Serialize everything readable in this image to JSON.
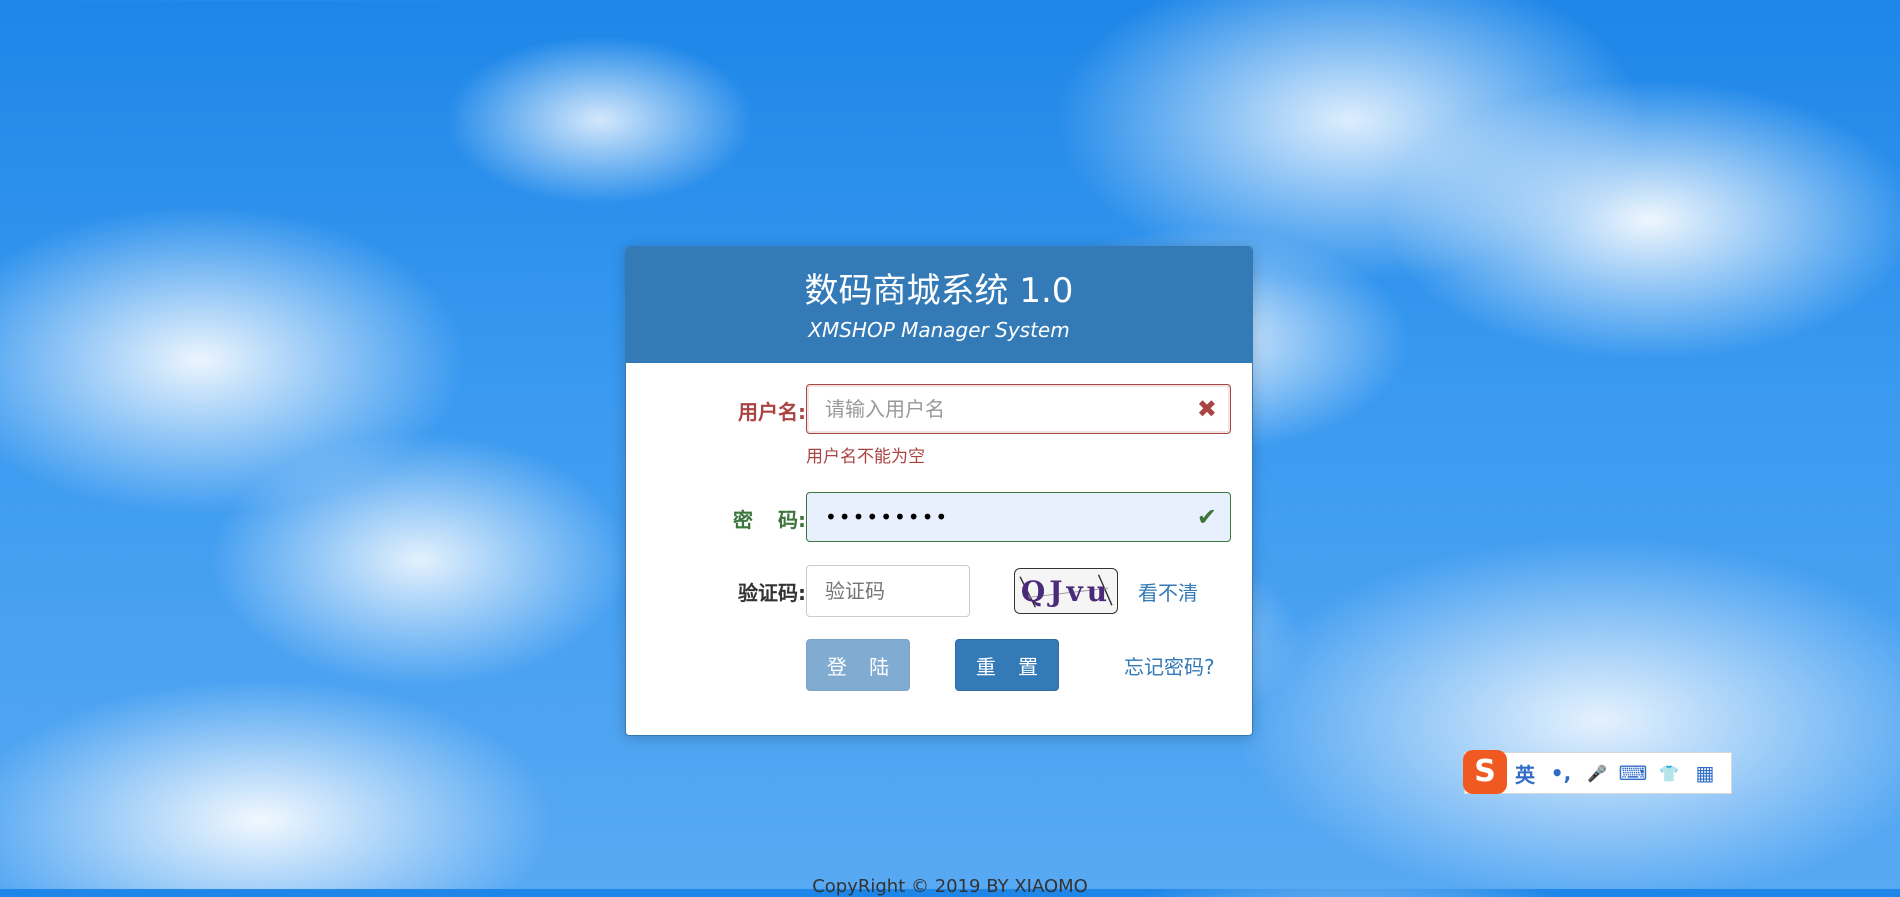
{
  "header": {
    "title": "数码商城系统 1.0",
    "subtitle": "XMSHOP Manager System"
  },
  "form": {
    "username": {
      "label": "用户名:",
      "placeholder": "请输入用户名",
      "value": "",
      "error": "用户名不能为空",
      "status_icon": "close-icon"
    },
    "password": {
      "label": "密 码:",
      "value": "•••••••••",
      "status_icon": "check-icon"
    },
    "captcha": {
      "label": "验证码:",
      "placeholder": "验证码",
      "image_text": "QJvu",
      "refresh_link": "看不清"
    },
    "buttons": {
      "login": "登 陆",
      "reset": "重 置"
    },
    "forgot_link": "忘记密码?"
  },
  "ime_toolbar": {
    "logo": "S",
    "items": [
      "英",
      "•,",
      "🎤",
      "⌨",
      "👕",
      "▦"
    ]
  },
  "footer": {
    "copyright": "CopyRight © 2019 BY XIAOMO"
  },
  "colors": {
    "primary": "#337ab7",
    "error": "#a94442",
    "success": "#3c763d"
  }
}
